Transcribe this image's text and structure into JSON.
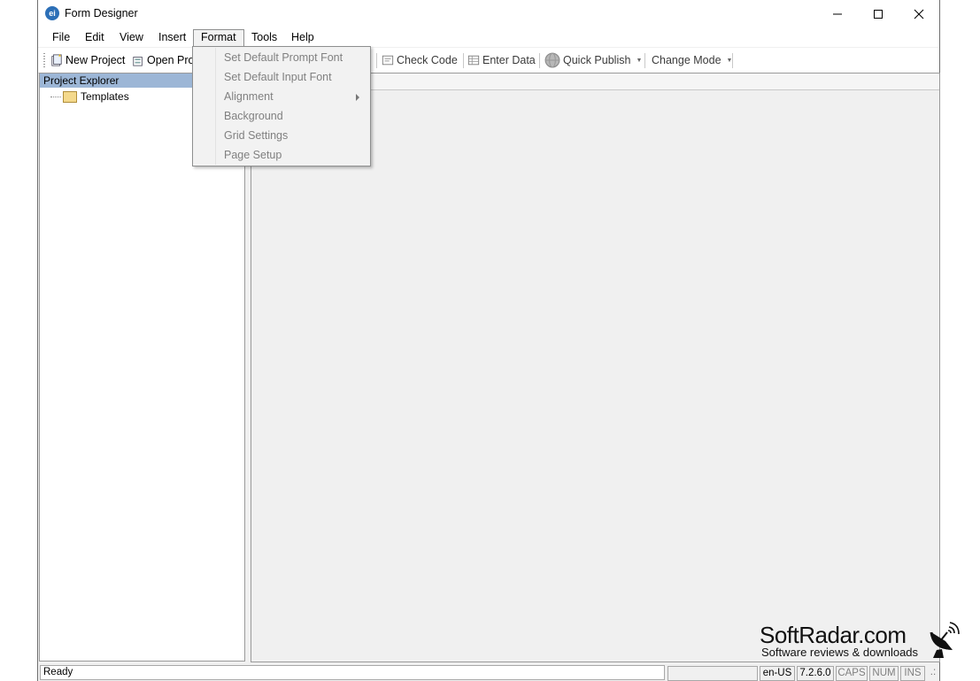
{
  "window": {
    "title": "Form Designer",
    "app_icon_text": "ei"
  },
  "menubar": {
    "items": [
      {
        "label": "File"
      },
      {
        "label": "Edit"
      },
      {
        "label": "View"
      },
      {
        "label": "Insert"
      },
      {
        "label": "Format"
      },
      {
        "label": "Tools"
      },
      {
        "label": "Help"
      }
    ],
    "open_menu": "Format"
  },
  "format_menu": {
    "items": [
      {
        "label": "Set Default Prompt Font",
        "enabled": false
      },
      {
        "label": "Set Default Input Font",
        "enabled": false
      },
      {
        "label": "Alignment",
        "enabled": false,
        "submenu": true
      },
      {
        "label": "Background",
        "enabled": false
      },
      {
        "label": "Grid Settings",
        "enabled": false
      },
      {
        "label": "Page Setup",
        "enabled": false
      }
    ]
  },
  "toolbar": {
    "new_project": "New Project",
    "open_project": "Open Pro",
    "check_code": "Check Code",
    "enter_data": "Enter Data",
    "quick_publish": "Quick Publish",
    "change_mode": "Change Mode"
  },
  "project_explorer": {
    "title": "Project Explorer",
    "tree": [
      {
        "label": "Templates",
        "icon": "folder-icon"
      }
    ]
  },
  "statusbar": {
    "status": "Ready",
    "locale": "en-US",
    "version": "7.2.6.0",
    "caps": "CAPS",
    "num": "NUM",
    "ins": "INS"
  },
  "watermark": {
    "brand": "SoftRadar.com",
    "tagline": "Software reviews & downloads"
  },
  "colors": {
    "pane_header": "#9cb6d6",
    "app_icon": "#2c6fb7",
    "disabled_text": "#808080"
  }
}
